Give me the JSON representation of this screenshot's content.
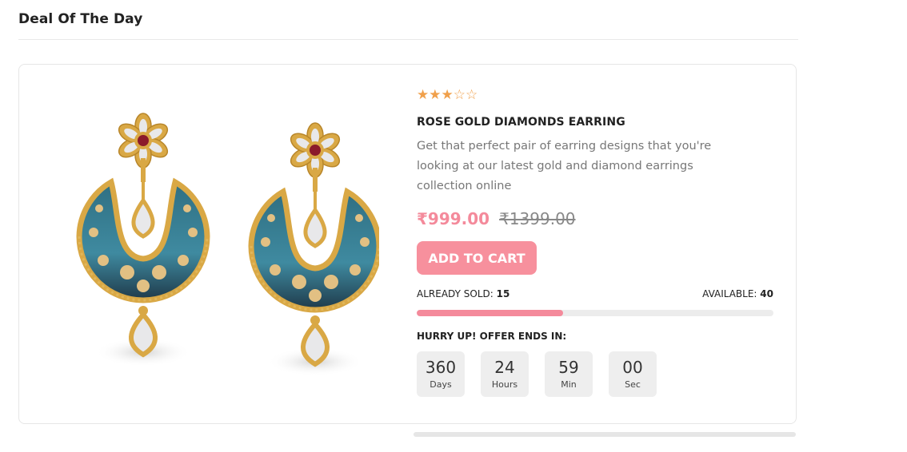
{
  "section": {
    "title": "Deal Of The Day"
  },
  "product": {
    "rating": 3,
    "rating_max": 5,
    "rating_stars": "★★★☆☆",
    "name": "ROSE GOLD DIAMONDS EARRING",
    "description": "Get that perfect pair of earring designs that you're looking at our latest gold and diamond earrings collection online",
    "price_now": "₹999.00",
    "price_old": "₹1399.00",
    "add_to_cart_label": "ADD TO CART",
    "already_sold_label": "ALREADY SOLD:",
    "already_sold_value": "15",
    "available_label": "AVAILABLE:",
    "available_value": "40",
    "sold_progress": 0.41
  },
  "countdown": {
    "heading": "HURRY UP! OFFER ENDS IN:",
    "units": [
      {
        "value": "360",
        "label": "Days"
      },
      {
        "value": "24",
        "label": "Hours"
      },
      {
        "value": "59",
        "label": "Min"
      },
      {
        "value": "00",
        "label": "Sec"
      }
    ]
  },
  "colors": {
    "accent": "#f48a9b",
    "button": "#f7909d",
    "star": "#f0a04b"
  }
}
